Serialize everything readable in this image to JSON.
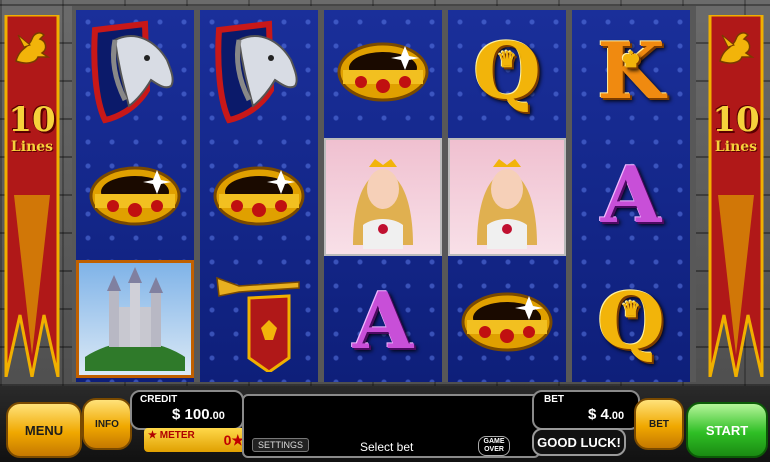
{
  "banner": {
    "lines_number": "10",
    "lines_label": "Lines"
  },
  "reels": [
    [
      "horse-shield",
      "ring",
      "castle"
    ],
    [
      "horse-shield",
      "ring",
      "trumpet"
    ],
    [
      "ring",
      "princess",
      "A"
    ],
    [
      "Q",
      "princess",
      "ring"
    ],
    [
      "K",
      "A",
      "Q"
    ]
  ],
  "controls": {
    "menu": "MENU",
    "info": "INFO",
    "credit_label": "CREDIT",
    "credit_value": "$ 100",
    "credit_cents": ".00",
    "meter_label": "★ METER",
    "meter_value": "0★",
    "settings": "SETTINGS",
    "message": "Select bet",
    "game_over_1": "GAME",
    "game_over_2": "OVER",
    "bet_label": "BET",
    "bet_value": "$ 4",
    "bet_cents": ".00",
    "good_luck": "GOOD LUCK!",
    "bet_button": "BET",
    "start": "START"
  },
  "colors": {
    "reel_blue": "#0e1f7a",
    "banner_red": "#b01818",
    "gold": "#f2b40a"
  }
}
